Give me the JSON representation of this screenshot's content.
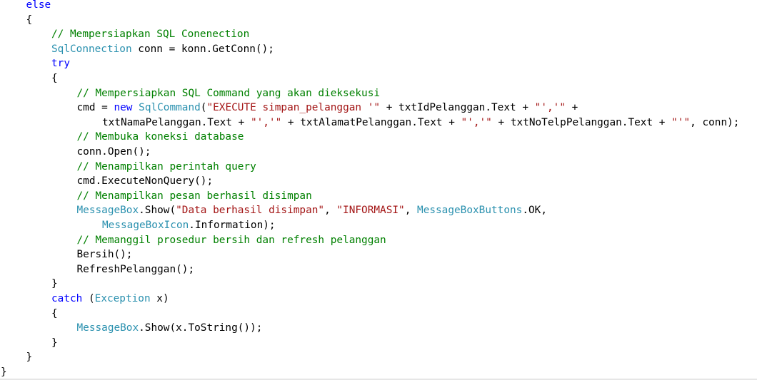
{
  "colors": {
    "keyword": "#0000ff",
    "comment": "#008000",
    "type": "#2b91af",
    "string": "#a31515",
    "plain": "#000000"
  },
  "code": {
    "lines": [
      {
        "indent": 1,
        "tokens": [
          {
            "t": "keyword",
            "text": "else"
          }
        ]
      },
      {
        "indent": 1,
        "tokens": [
          {
            "t": "plain",
            "text": "{"
          }
        ]
      },
      {
        "indent": 2,
        "tokens": [
          {
            "t": "comment",
            "text": "// Mempersiapkan SQL Conenection"
          }
        ]
      },
      {
        "indent": 2,
        "tokens": [
          {
            "t": "type",
            "text": "SqlConnection"
          },
          {
            "t": "plain",
            "text": " conn = konn.GetConn();"
          }
        ]
      },
      {
        "indent": 2,
        "tokens": [
          {
            "t": "keyword",
            "text": "try"
          }
        ]
      },
      {
        "indent": 2,
        "tokens": [
          {
            "t": "plain",
            "text": "{"
          }
        ]
      },
      {
        "indent": 3,
        "tokens": [
          {
            "t": "comment",
            "text": "// Mempersiapkan SQL Command yang akan dieksekusi"
          }
        ]
      },
      {
        "indent": 3,
        "tokens": [
          {
            "t": "plain",
            "text": "cmd = "
          },
          {
            "t": "keyword",
            "text": "new"
          },
          {
            "t": "plain",
            "text": " "
          },
          {
            "t": "type",
            "text": "SqlCommand"
          },
          {
            "t": "plain",
            "text": "("
          },
          {
            "t": "string",
            "text": "\"EXECUTE simpan_pelanggan '\""
          },
          {
            "t": "plain",
            "text": " + txtIdPelanggan.Text + "
          },
          {
            "t": "string",
            "text": "\"','\""
          },
          {
            "t": "plain",
            "text": " +"
          }
        ]
      },
      {
        "indent": 4,
        "tokens": [
          {
            "t": "plain",
            "text": "txtNamaPelanggan.Text + "
          },
          {
            "t": "string",
            "text": "\"','\""
          },
          {
            "t": "plain",
            "text": " + txtAlamatPelanggan.Text + "
          },
          {
            "t": "string",
            "text": "\"','\""
          },
          {
            "t": "plain",
            "text": " + txtNoTelpPelanggan.Text + "
          },
          {
            "t": "string",
            "text": "\"'\""
          },
          {
            "t": "plain",
            "text": ", conn);"
          }
        ]
      },
      {
        "indent": 3,
        "tokens": [
          {
            "t": "comment",
            "text": "// Membuka koneksi database"
          }
        ]
      },
      {
        "indent": 3,
        "tokens": [
          {
            "t": "plain",
            "text": "conn.Open();"
          }
        ]
      },
      {
        "indent": 3,
        "tokens": [
          {
            "t": "comment",
            "text": "// Menampilkan perintah query"
          }
        ]
      },
      {
        "indent": 3,
        "tokens": [
          {
            "t": "plain",
            "text": "cmd.ExecuteNonQuery();"
          }
        ]
      },
      {
        "indent": 3,
        "tokens": [
          {
            "t": "comment",
            "text": "// Menampilkan pesan berhasil disimpan"
          }
        ]
      },
      {
        "indent": 3,
        "tokens": [
          {
            "t": "type",
            "text": "MessageBox"
          },
          {
            "t": "plain",
            "text": ".Show("
          },
          {
            "t": "string",
            "text": "\"Data berhasil disimpan\""
          },
          {
            "t": "plain",
            "text": ", "
          },
          {
            "t": "string",
            "text": "\"INFORMASI\""
          },
          {
            "t": "plain",
            "text": ", "
          },
          {
            "t": "type",
            "text": "MessageBoxButtons"
          },
          {
            "t": "plain",
            "text": ".OK,"
          }
        ]
      },
      {
        "indent": 4,
        "tokens": [
          {
            "t": "type",
            "text": "MessageBoxIcon"
          },
          {
            "t": "plain",
            "text": ".Information);"
          }
        ]
      },
      {
        "indent": 3,
        "tokens": [
          {
            "t": "comment",
            "text": "// Memanggil prosedur bersih dan refresh pelanggan"
          }
        ]
      },
      {
        "indent": 3,
        "tokens": [
          {
            "t": "plain",
            "text": "Bersih();"
          }
        ]
      },
      {
        "indent": 3,
        "tokens": [
          {
            "t": "plain",
            "text": "RefreshPelanggan();"
          }
        ]
      },
      {
        "indent": 2,
        "tokens": [
          {
            "t": "plain",
            "text": "}"
          }
        ]
      },
      {
        "indent": 2,
        "tokens": [
          {
            "t": "keyword",
            "text": "catch"
          },
          {
            "t": "plain",
            "text": " ("
          },
          {
            "t": "type",
            "text": "Exception"
          },
          {
            "t": "plain",
            "text": " x)"
          }
        ]
      },
      {
        "indent": 2,
        "tokens": [
          {
            "t": "plain",
            "text": "{"
          }
        ]
      },
      {
        "indent": 3,
        "tokens": [
          {
            "t": "type",
            "text": "MessageBox"
          },
          {
            "t": "plain",
            "text": ".Show(x.ToString());"
          }
        ]
      },
      {
        "indent": 2,
        "tokens": [
          {
            "t": "plain",
            "text": "}"
          }
        ]
      },
      {
        "indent": 1,
        "tokens": [
          {
            "t": "plain",
            "text": "}"
          }
        ]
      },
      {
        "indent": 0,
        "tokens": [
          {
            "t": "plain",
            "text": "}"
          }
        ]
      }
    ]
  }
}
